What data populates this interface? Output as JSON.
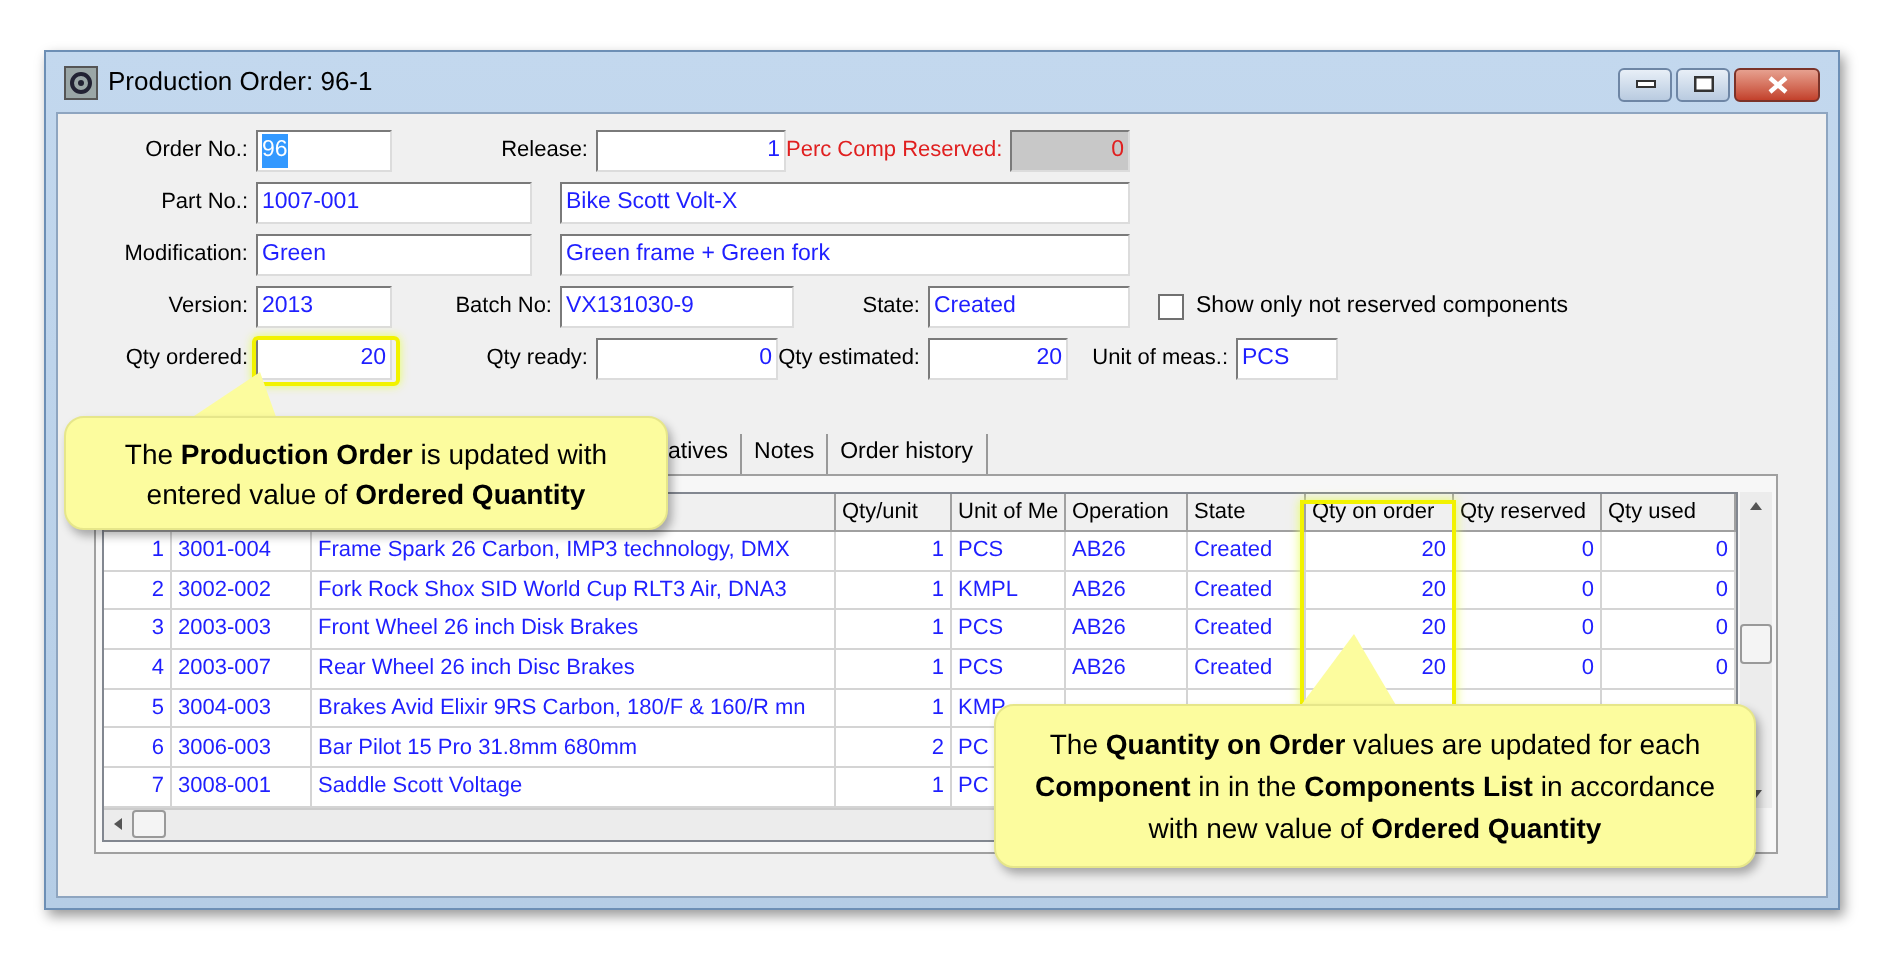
{
  "window": {
    "title": "Production Order: 96-1"
  },
  "form": {
    "order_no": {
      "label": "Order No.:",
      "value": "96",
      "value_selected": true
    },
    "release": {
      "label": "Release:",
      "value": "1"
    },
    "perc_comp_reserved": {
      "label": "Perc Comp Reserved:",
      "value": "0",
      "disabled": true
    },
    "part_no": {
      "label": "Part No.:",
      "value": "1007-001",
      "description": "Bike Scott Volt-X"
    },
    "modification": {
      "label": "Modification:",
      "value": "Green",
      "description": "Green frame + Green fork"
    },
    "version": {
      "label": "Version:",
      "value": "2013"
    },
    "batch_no": {
      "label": "Batch No:",
      "value": "VX131030-9"
    },
    "state": {
      "label": "State:",
      "value": "Created"
    },
    "show_only_not_reserved": {
      "label": "Show only not reserved components",
      "checked": false
    },
    "qty_ordered": {
      "label": "Qty ordered:",
      "value": "20"
    },
    "qty_ready": {
      "label": "Qty ready:",
      "value": "0"
    },
    "qty_estimated": {
      "label": "Qty estimated:",
      "value": "20"
    },
    "unit_of_meas": {
      "label": "Unit of meas.:",
      "value": "PCS"
    }
  },
  "tabs": [
    {
      "label": "atives",
      "selected": false
    },
    {
      "label": "Notes",
      "selected": false
    },
    {
      "label": "Order history",
      "selected": false
    }
  ],
  "table": {
    "columns": [
      null,
      null,
      null,
      "Qty/unit",
      "Unit of Me",
      "Operation",
      "State",
      "Qty on order",
      "Qty reserved",
      "Qty used"
    ],
    "rows": [
      [
        "1",
        "3001-004",
        "Frame Spark 26 Carbon, IMP3 technology, DMX",
        "1",
        "PCS",
        "AB26",
        "Created",
        "20",
        "0",
        "0"
      ],
      [
        "2",
        "3002-002",
        "Fork Rock Shox SID World Cup RLT3 Air, DNA3",
        "1",
        "KMPL",
        "AB26",
        "Created",
        "20",
        "0",
        "0"
      ],
      [
        "3",
        "2003-003",
        "Front Wheel 26 inch Disk Brakes",
        "1",
        "PCS",
        "AB26",
        "Created",
        "20",
        "0",
        "0"
      ],
      [
        "4",
        "2003-007",
        "Rear Wheel 26 inch Disc Brakes",
        "1",
        "PCS",
        "AB26",
        "Created",
        "20",
        "0",
        "0"
      ],
      [
        "5",
        "3004-003",
        "Brakes Avid Elixir 9RS Carbon, 180/F & 160/R mn",
        "1",
        "KMP"
      ],
      [
        "6",
        "3006-003",
        "Bar Pilot 15 Pro 31.8mm 680mm",
        "2",
        "PC"
      ],
      [
        "7",
        "3008-001",
        "Saddle Scott Voltage",
        "1",
        "PC"
      ]
    ]
  },
  "callouts": [
    {
      "text": "The **Production Order** is updated with entered value of **Ordered Quantity**"
    },
    {
      "text": "The **Quantity on Order** values are updated for each **Component** in in the **Components List** in accordance with new value of **Ordered Quantity**"
    }
  ]
}
